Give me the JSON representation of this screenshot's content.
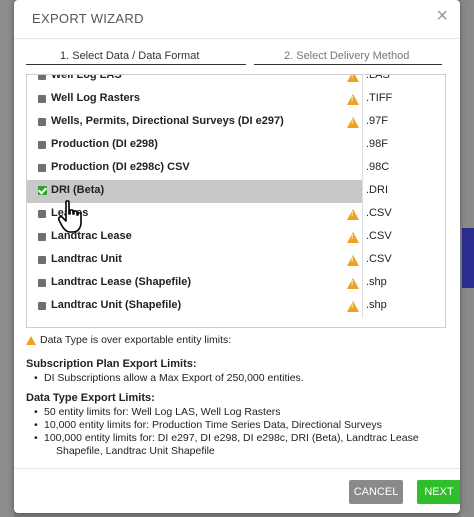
{
  "modal": {
    "title": "EXPORT WIZARD",
    "close_glyph": "×"
  },
  "tabs": [
    {
      "label": "1. Select Data / Data Format",
      "active": true
    },
    {
      "label": "2. Select Delivery Method",
      "active": false
    }
  ],
  "rows": [
    {
      "label": "Well Log LAS",
      "ext": ".LAS",
      "warn": true,
      "checked": false
    },
    {
      "label": "Well Log Rasters",
      "ext": ".TIFF",
      "warn": true,
      "checked": false
    },
    {
      "label": "Wells, Permits, Directional Surveys (DI e297)",
      "ext": ".97F",
      "warn": true,
      "checked": false
    },
    {
      "label": "Production (DI e298)",
      "ext": ".98F",
      "warn": false,
      "checked": false
    },
    {
      "label": "Production (DI e298c) CSV",
      "ext": ".98C",
      "warn": false,
      "checked": false
    },
    {
      "label": "DRI (Beta)",
      "ext": ".DRI",
      "warn": false,
      "checked": true,
      "selected": true
    },
    {
      "label": "Leases",
      "ext": ".CSV",
      "warn": true,
      "checked": false
    },
    {
      "label": "Landtrac Lease",
      "ext": ".CSV",
      "warn": true,
      "checked": false
    },
    {
      "label": "Landtrac Unit",
      "ext": ".CSV",
      "warn": true,
      "checked": false
    },
    {
      "label": "Landtrac Lease (Shapefile)",
      "ext": ".shp",
      "warn": true,
      "checked": false
    },
    {
      "label": "Landtrac Unit (Shapefile)",
      "ext": ".shp",
      "warn": true,
      "checked": false
    }
  ],
  "notes": {
    "warning": "Data Type is over exportable entity limits:",
    "subscription_heading": "Subscription Plan Export Limits:",
    "subscription_bullets": [
      "DI Subscriptions allow a Max Export of 250,000 entities."
    ],
    "datatype_heading": "Data Type Export Limits:",
    "datatype_bullets": [
      "50 entity limits for: Well Log LAS, Well Log Rasters",
      "10,000 entity limits for: Production Time Series Data, Directional Surveys",
      "100,000 entity limits for: DI e297, DI e298, DI e298c, DRI (Beta), Landtrac Lease"
    ],
    "datatype_bullet3_cont": "Shapefile, Landtrac Unit Shapefile"
  },
  "footer": {
    "cancel_label": "CANCEL",
    "next_label": "NEXT"
  },
  "colors": {
    "next": "#2fbf2a",
    "cancel": "#8a8a8a",
    "warning": "#f0a11e",
    "checked": "#31a32c"
  }
}
